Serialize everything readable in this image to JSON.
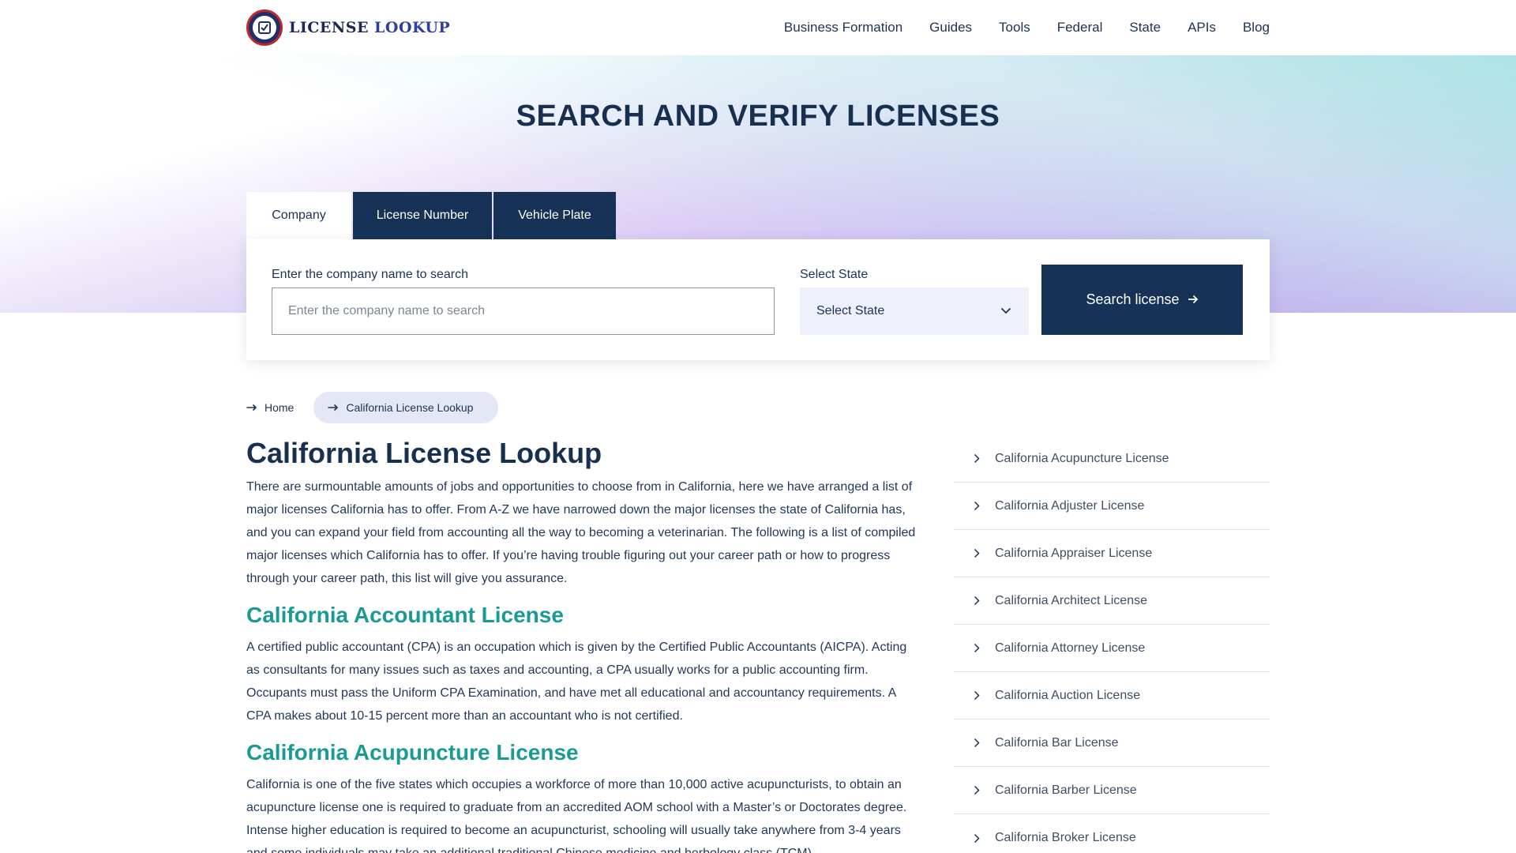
{
  "header": {
    "logo_word1": "LICENSE",
    "logo_word2": "LOOKUP",
    "nav": [
      "Business Formation",
      "Guides",
      "Tools",
      "Federal",
      "State",
      "APIs",
      "Blog"
    ]
  },
  "hero": {
    "title": "SEARCH AND VERIFY LICENSES"
  },
  "tabs": [
    "Company",
    "License Number",
    "Vehicle Plate"
  ],
  "search": {
    "company_label": "Enter the company name to search",
    "company_placeholder": "Enter the company name to search",
    "state_label": "Select State",
    "state_selected": "Select State",
    "button_label": "Search license"
  },
  "breadcrumb": [
    "Home",
    "California License Lookup"
  ],
  "content": {
    "title": "California License Lookup",
    "intro": "There are surmountable amounts of jobs and opportunities to choose from in California, here we have arranged a list of major licenses California has to offer. From A-Z we have narrowed down the major licenses the state of California has, and you can expand your field from accounting all the way to becoming a veterinarian. The following is a list of compiled major licenses which California has to offer. If you’re having trouble figuring out your career path or how to progress through your career path, this list will give you assurance.",
    "sections": [
      {
        "heading": "California Accountant License",
        "text": "A certified public accountant (CPA) is an occupation which is given by the Certified Public Accountants (AICPA). Acting as consultants for many issues such as taxes and accounting, a CPA usually works for a public accounting firm. Occupants must pass the Uniform CPA Examination, and have met all educational and accountancy requirements. A CPA makes about 10-15 percent more than an accountant who is not certified."
      },
      {
        "heading": "California Acupuncture License",
        "text": "California is one of the five states which occupies a workforce of more than 10,000 active acupuncturists, to obtain an acupuncture license one is required to graduate from an accredited AOM school with a Master’s or Doctorates degree. Intense higher education is required to become an acupuncturist, schooling will usually take anywhere from 3-4 years and some individuals may take an additional traditional Chinese medicine and herbology class (TCM)."
      }
    ]
  },
  "sidebar": [
    "California Acupuncture License",
    "California Adjuster License",
    "California Appraiser License",
    "California Architect License",
    "California Attorney License",
    "California Auction License",
    "California Bar License",
    "California Barber License",
    "California Broker License"
  ],
  "icons": {
    "logo": "shield-check-badge-icon",
    "select": "chevron-down-icon",
    "button": "arrow-right-icon",
    "breadcrumb": "arrow-right-icon",
    "sidebar": "chevron-right-icon"
  },
  "colors": {
    "navy": "#163257",
    "teal_heading": "#1a9a94",
    "select_bg": "#eef0fb"
  }
}
